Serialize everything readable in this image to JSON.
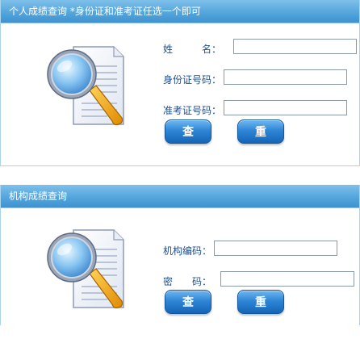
{
  "personal": {
    "header": "个人成绩查询 *身份证和准考证任选一个即可",
    "name_label": "姓　　　名：",
    "id_label": "身份证号码：",
    "exam_label": "准考证号码：",
    "name_value": "",
    "id_value": "",
    "exam_value": "",
    "query_button": "查 询",
    "reset_button": "重 置"
  },
  "institution": {
    "header": "机构成绩查询",
    "code_label": "机构编码：",
    "password_label": "密　　码：",
    "code_value": "",
    "password_value": "",
    "query_button": "查 询",
    "reset_button": "重 置"
  },
  "icons": {
    "panel_icon": "document-magnifier-icon"
  },
  "colors": {
    "header_blue": "#4a9fd9",
    "label_text": "#1f4f8f",
    "button_blue": "#2f86d6",
    "panel_border": "#a9d3ef"
  }
}
